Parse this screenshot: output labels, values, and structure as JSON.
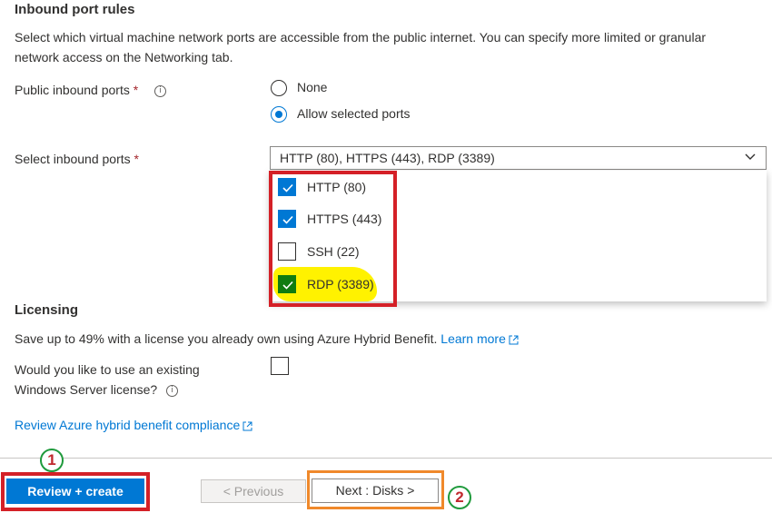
{
  "inbound": {
    "title": "Inbound port rules",
    "description_line1": "Select which virtual machine network ports are accessible from the public internet. You can specify more limited or granular",
    "description_line2": "network access on the Networking tab.",
    "public_ports_label": "Public inbound ports",
    "required_mark": "*",
    "info_glyph": "i",
    "radio_options": [
      {
        "label": "None",
        "checked": false
      },
      {
        "label": "Allow selected ports",
        "checked": true
      }
    ],
    "select_ports_label": "Select inbound ports",
    "select_value": "HTTP (80), HTTPS (443), RDP (3389)",
    "options": [
      {
        "label": "HTTP (80)",
        "checked": true
      },
      {
        "label": "HTTPS (443)",
        "checked": true
      },
      {
        "label": "SSH (22)",
        "checked": false
      },
      {
        "label": "RDP (3389)",
        "checked": true
      }
    ]
  },
  "licensing": {
    "title": "Licensing",
    "description": "Save up to 49% with a license you already own using Azure Hybrid Benefit.",
    "learn_more": "Learn more",
    "question_line1": "Would you like to use an existing",
    "question_line2": "Windows Server license?",
    "compliance_link": "Review Azure hybrid benefit compliance"
  },
  "footer": {
    "review_create": "Review + create",
    "previous": "< Previous",
    "next": "Next : Disks >"
  },
  "annotations": {
    "step1": "1",
    "step2": "2"
  },
  "colors": {
    "accent": "#0078d4",
    "annotation_red": "#d42027",
    "annotation_orange": "#f0892b",
    "annotation_green": "#1f9a3c",
    "highlight_yellow": "#fff200",
    "rdp_check_green": "#107c10"
  }
}
